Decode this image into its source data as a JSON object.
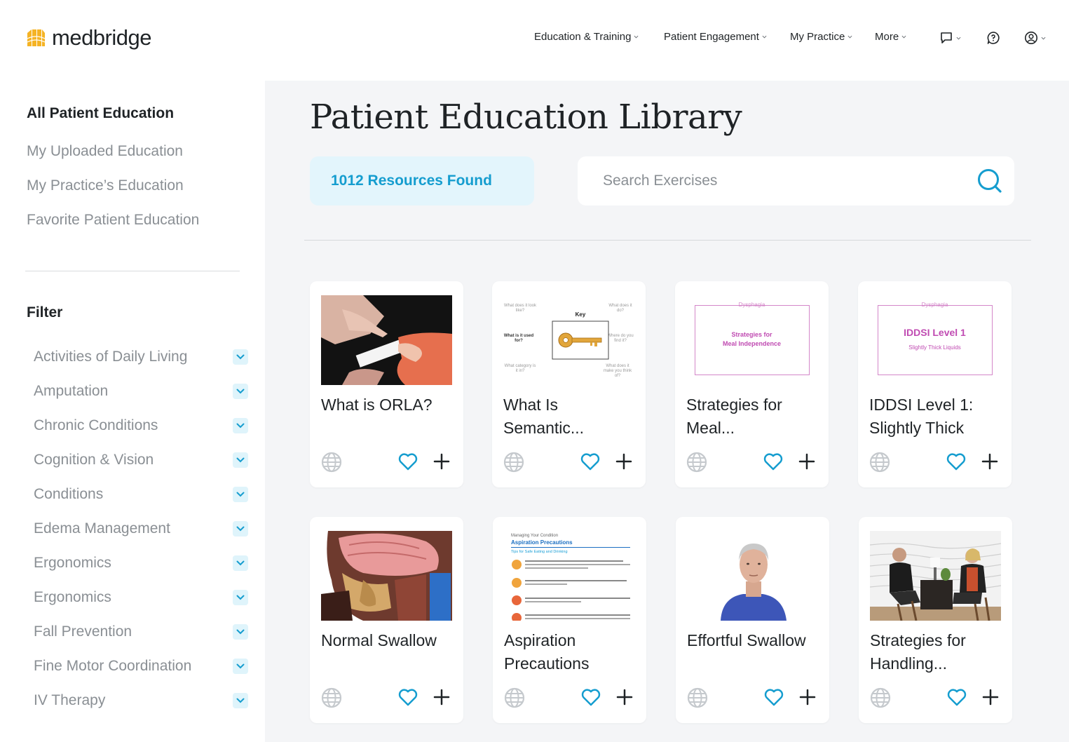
{
  "brand": {
    "name": "medbridge",
    "accent": "#f5b324",
    "link_color": "#159dcf"
  },
  "nav": {
    "items": [
      {
        "label": "Education & Training"
      },
      {
        "label": "Patient Engagement"
      },
      {
        "label": "My Practice"
      },
      {
        "label": "More"
      }
    ],
    "icons": [
      "message-icon",
      "help-chat-icon",
      "account-icon"
    ]
  },
  "sidebar": {
    "links": [
      {
        "label": "All Patient Education",
        "active": true
      },
      {
        "label": "My Uploaded Education",
        "active": false
      },
      {
        "label": "My Practice’s Education",
        "active": false
      },
      {
        "label": "Favorite Patient Education",
        "active": false
      }
    ],
    "filter_title": "Filter",
    "filters": [
      "Activities of Daily Living",
      "Amputation",
      "Chronic Conditions",
      "Cognition & Vision",
      "Conditions",
      "Edema Management",
      "Ergonomics",
      "Ergonomics",
      "Fall Prevention",
      "Fine Motor Coordination",
      "IV Therapy"
    ]
  },
  "main": {
    "title": "Patient Education Library",
    "results": "1012 Resources Found",
    "search": {
      "placeholder": "Search Exercises",
      "value": ""
    },
    "cards": [
      {
        "title": "What is ORLA?",
        "thumb": "orla-photo"
      },
      {
        "title": "What Is Semantic...",
        "thumb": "semantic-key-diagram",
        "thumb_text": {
          "q1": "What does it look like?",
          "q2": "What does it do?",
          "q3": "What is it used for?",
          "q4": "Where do you find it?",
          "q5": "What category is it in?",
          "q6": "What does it make you think of?",
          "center": "Key"
        }
      },
      {
        "title": "Strategies for Meal...",
        "thumb": "dysphagia-cover",
        "thumb_text": {
          "header": "Dysphagia",
          "line1": "Strategies for",
          "line2": "Meal Independence"
        }
      },
      {
        "title": "IDDSI Level 1: Slightly Thick",
        "thumb": "dysphagia-cover",
        "thumb_text": {
          "header": "Dysphagia",
          "line1": "IDDSI Level 1",
          "line2": "Slightly Thick Liquids"
        }
      },
      {
        "title": "Normal Swallow",
        "thumb": "anatomy-illustration"
      },
      {
        "title": "Aspiration Precautions",
        "thumb": "handout",
        "thumb_text": {
          "kicker": "Managing Your Condition",
          "heading": "Aspiration Precautions",
          "sub": "Tips for Safe Eating and Drinking"
        }
      },
      {
        "title": "Effortful Swallow",
        "thumb": "person-photo"
      },
      {
        "title": "Strategies for Handling...",
        "thumb": "conversation-photo"
      }
    ]
  }
}
